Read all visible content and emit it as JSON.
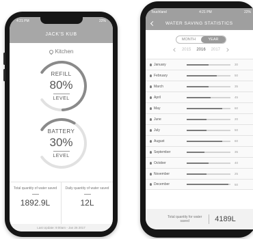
{
  "left": {
    "status": {
      "time": "4:21 PM",
      "battery": "22%"
    },
    "title": "JACK'S KUB",
    "location": "Kitchen",
    "gauges": [
      {
        "title": "REFILL",
        "value": "80%",
        "subtitle": "LEVEL",
        "fraction": 0.8
      },
      {
        "title": "BATTERY",
        "value": "30%",
        "subtitle": "LEVEL",
        "fraction": 0.3
      }
    ],
    "totals": [
      {
        "label": "Total quantity of water saved",
        "value": "1892.9L"
      },
      {
        "label": "Daily quantity of water saved",
        "value": "12L"
      }
    ],
    "last_update": "Last Update: 9:00am - Jan 26 2017"
  },
  "right": {
    "status": {
      "carrier": "Touchland",
      "time": "4:21 PM",
      "battery": "22%"
    },
    "title": "WATER SAVING STATISTICS",
    "toggle": {
      "month": "MONTH",
      "year": "YEAR",
      "selected": "YEAR"
    },
    "years": {
      "prev": "2015",
      "current": "2016",
      "next": "2017"
    },
    "months": [
      {
        "name": "January",
        "value": "30",
        "level": 0.5
      },
      {
        "name": "February",
        "value": "50",
        "level": 0.68
      },
      {
        "name": "March",
        "value": "35",
        "level": 0.5
      },
      {
        "name": "April",
        "value": "45",
        "level": 0.55
      },
      {
        "name": "May",
        "value": "60",
        "level": 0.82
      },
      {
        "name": "June",
        "value": "20",
        "level": 0.45
      },
      {
        "name": "July",
        "value": "50",
        "level": 0.45
      },
      {
        "name": "August",
        "value": "60",
        "level": 0.82
      },
      {
        "name": "September",
        "value": "35",
        "level": 0.4
      },
      {
        "name": "October",
        "value": "40",
        "level": 0.5
      },
      {
        "name": "November",
        "value": "25",
        "level": 0.45
      },
      {
        "name": "December",
        "value": "50",
        "level": 0.95
      }
    ],
    "total": {
      "label": "Total quantity for water saved",
      "value": "4189L"
    }
  }
}
